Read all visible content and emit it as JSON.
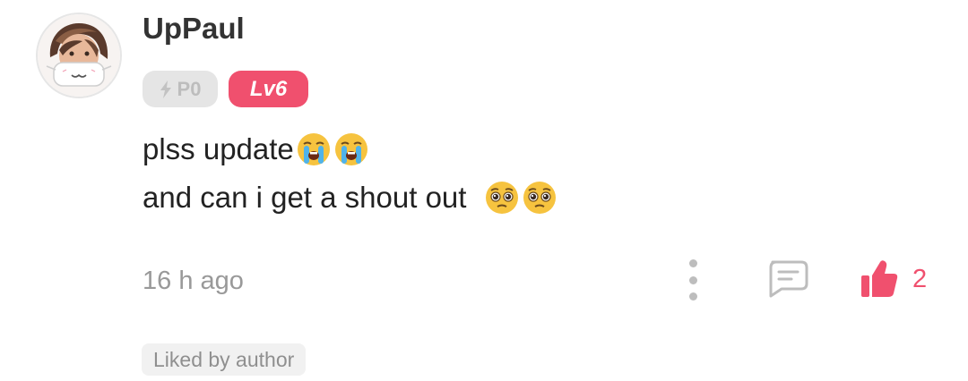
{
  "comment": {
    "username": "UpPaul",
    "badges": {
      "power_label": "P0",
      "level_label": "Lv6"
    },
    "text_lines": [
      "plss update",
      "and can i get a shout out "
    ],
    "emojis": {
      "line1": [
        "loudly-crying-face",
        "loudly-crying-face"
      ],
      "line2": [
        "pleading-face",
        "pleading-face"
      ]
    },
    "timestamp": "16 h ago",
    "like_count": "2",
    "liked_by_author_label": "Liked by author"
  },
  "colors": {
    "accent": "#f0506e",
    "muted_text": "#999999",
    "badge_gray": "#e5e5e5"
  },
  "icons": {
    "avatar": "user-avatar",
    "power": "lightning-bolt-icon",
    "more": "more-vertical-icon",
    "reply": "comment-bubble-icon",
    "like": "thumbs-up-icon"
  }
}
